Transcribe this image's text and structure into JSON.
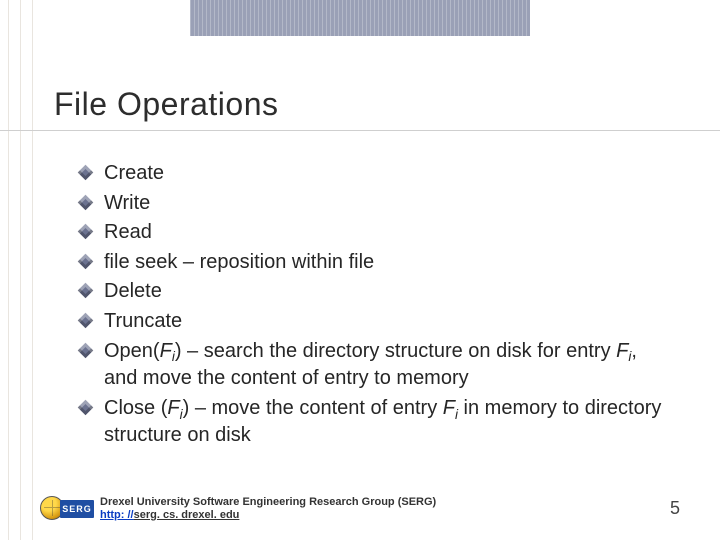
{
  "title": "File Operations",
  "bullets": {
    "b0": "Create",
    "b1": "Write",
    "b2": "Read",
    "b3": "file seek – reposition within file",
    "b4": "Delete",
    "b5": "Truncate",
    "open": {
      "pre": "Open(",
      "F": "F",
      "i": "i",
      "post": ") – search the directory structure on disk for entry ",
      "F2": "F",
      "i2": "i",
      "post2": ", and move the content of entry to memory"
    },
    "close": {
      "pre": "Close (",
      "F": "F",
      "i": "i",
      "post": ") – move the content of entry ",
      "F2": "F",
      "i2": "i",
      "post2": " in memory to directory structure on disk"
    }
  },
  "footer": {
    "logo_label": "SERG",
    "line": "Drexel University Software Engineering Research Group (SERG)",
    "link_prefix": "http: //",
    "link_rest": "serg. cs. drexel. edu"
  },
  "page_number": "5"
}
